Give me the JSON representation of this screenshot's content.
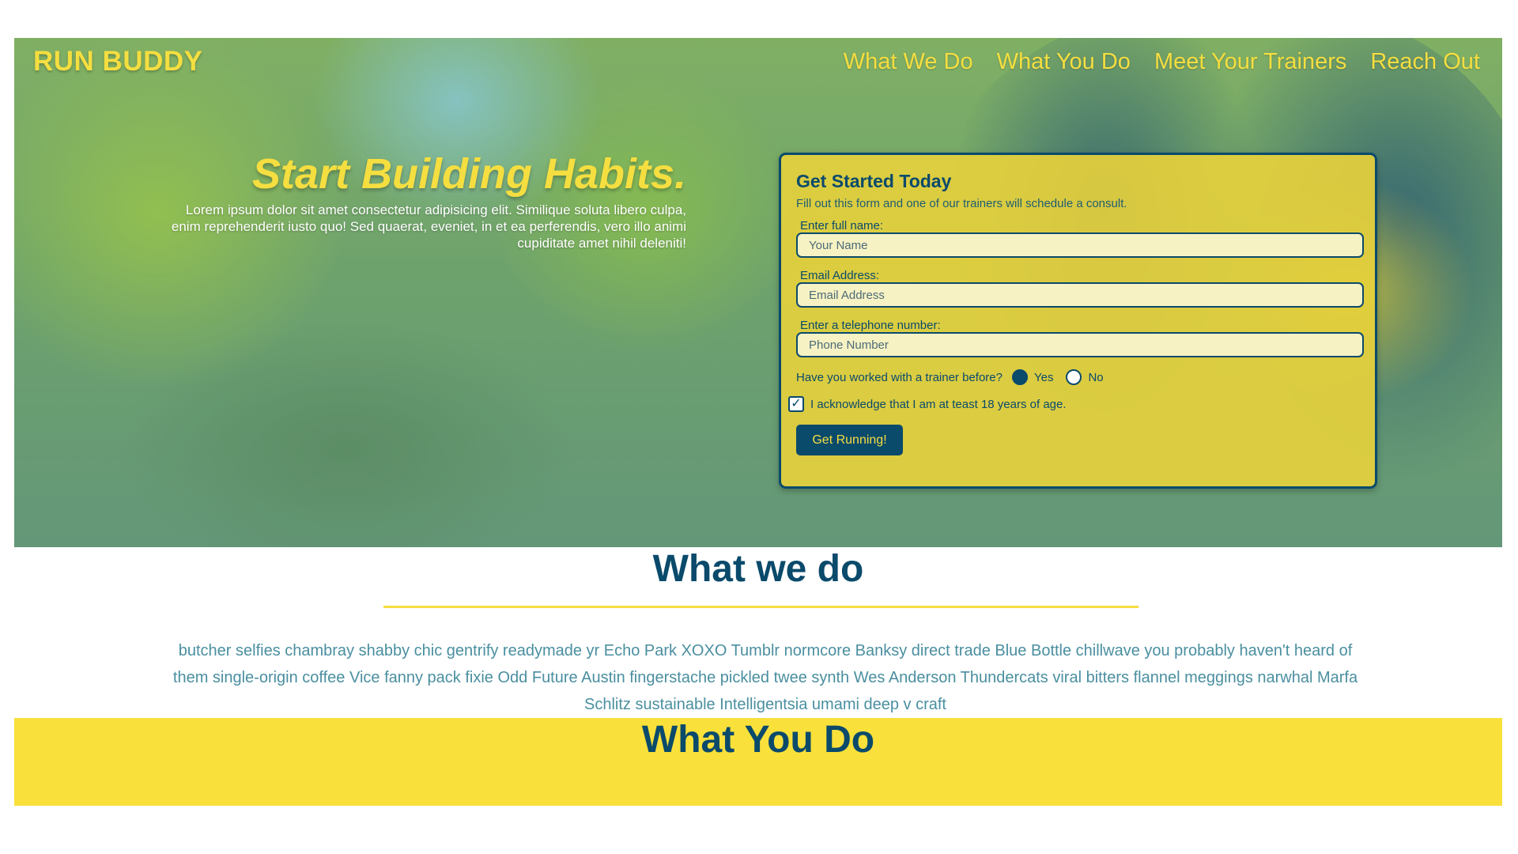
{
  "header": {
    "brand": "RUN BUDDY",
    "nav": [
      "What We Do",
      "What You Do",
      "Meet Your Trainers",
      "Reach Out"
    ]
  },
  "hero": {
    "title": "Start Building Habits.",
    "text": "Lorem ipsum dolor sit amet consectetur adipisicing elit. Similique soluta libero culpa, enim reprehenderit iusto quo! Sed quaerat, eveniet, in et ea perferendis, vero illo animi cupiditate amet nihil deleniti!"
  },
  "form": {
    "title": "Get Started Today",
    "subtitle": "Fill out this form and one of our trainers will schedule a consult.",
    "fields": [
      {
        "label": "Enter full name:",
        "placeholder": "Your Name",
        "value": ""
      },
      {
        "label": "Email Address:",
        "placeholder": "Email Address",
        "value": ""
      },
      {
        "label": "Enter a telephone number:",
        "placeholder": "Phone Number",
        "value": ""
      }
    ],
    "radio_question": "Have you worked with a trainer before?",
    "radio_options": [
      {
        "label": "Yes",
        "checked": true
      },
      {
        "label": "No",
        "checked": false
      }
    ],
    "checkbox_label": "I acknowledge that I am at teast 18 years of age.",
    "checkbox_checked": true,
    "checkbox_mark": "✓",
    "submit_label": "Get Running!"
  },
  "what_we_do": {
    "title": "What we do",
    "text": "butcher selfies chambray shabby chic gentrify readymade yr Echo Park XOXO Tumblr normcore Banksy direct trade Blue Bottle chillwave you probably haven't heard of them single-origin coffee Vice fanny pack fixie Odd Future Austin fingerstache pickled twee synth Wes Anderson Thundercats viral bitters flannel meggings narwhal Marfa Schlitz sustainable Intelligentsia umami deep v craft"
  },
  "what_you_do": {
    "title": "What You Do"
  },
  "colors": {
    "brand_yellow": "#f5de40",
    "navy": "#0a4a6b",
    "teal_text": "#4a8fa0",
    "section_yellow": "#f9e03a"
  },
  "icons": [
    "radio-icon",
    "checkbox-check-icon"
  ]
}
